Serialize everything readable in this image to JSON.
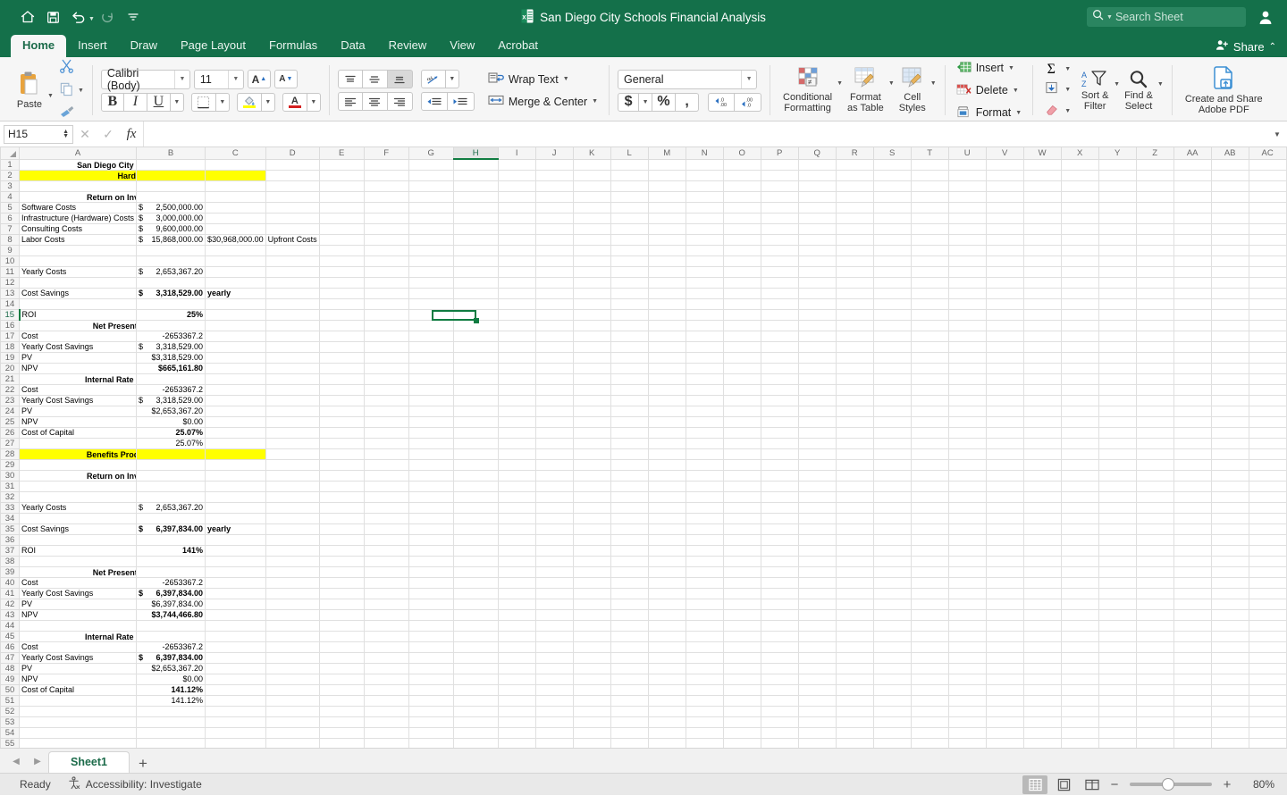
{
  "titlebar": {
    "document_title": "San Diego City Schools Financial Analysis",
    "search_placeholder": "Search Sheet",
    "quick_access": [
      {
        "name": "home-icon",
        "label": "Home"
      },
      {
        "name": "save-icon",
        "label": "Save"
      },
      {
        "name": "undo-icon",
        "label": "Undo"
      },
      {
        "name": "redo-icon",
        "label": "Redo"
      },
      {
        "name": "customize-toolbar-icon",
        "label": "Customize"
      }
    ],
    "account_icon": "account-icon"
  },
  "tabs": [
    {
      "label": "Home",
      "active": true
    },
    {
      "label": "Insert",
      "active": false
    },
    {
      "label": "Draw",
      "active": false
    },
    {
      "label": "Page Layout",
      "active": false
    },
    {
      "label": "Formulas",
      "active": false
    },
    {
      "label": "Data",
      "active": false
    },
    {
      "label": "Review",
      "active": false
    },
    {
      "label": "View",
      "active": false
    },
    {
      "label": "Acrobat",
      "active": false
    }
  ],
  "share": {
    "label": "Share",
    "collapse_icon": "chevron-up-icon"
  },
  "ribbon": {
    "paste": "Paste",
    "cut": "cut-icon",
    "copy": "copy-icon",
    "format_painter": "format-painter-icon",
    "font_name": "Calibri (Body)",
    "font_size": "11",
    "grow_font": "A",
    "shrink_font": "A",
    "bold": "B",
    "italic": "I",
    "underline": "U",
    "wrap_text": "Wrap Text",
    "merge_center": "Merge & Center",
    "number_format": "General",
    "currency": "$",
    "percent": "%",
    "comma": ",",
    "decrease_decimal": ".00",
    "increase_decimal": ".00",
    "conditional_formatting": "Conditional\nFormatting",
    "conditional_formatting_l1": "Conditional",
    "conditional_formatting_l2": "Formatting",
    "format_as_table_l1": "Format",
    "format_as_table_l2": "as Table",
    "cell_styles_l1": "Cell",
    "cell_styles_l2": "Styles",
    "insert": "Insert",
    "delete": "Delete",
    "format": "Format",
    "autosum": "Σ",
    "fill": "fill-icon",
    "clear": "clear-icon",
    "sort_filter_l1": "Sort &",
    "sort_filter_l2": "Filter",
    "find_select_l1": "Find &",
    "find_select_l2": "Select",
    "adobe_l1": "Create and Share",
    "adobe_l2": "Adobe PDF"
  },
  "formula_bar": {
    "name_box": "H15",
    "cancel_icon": "close-icon",
    "enter_icon": "check-icon",
    "fx_icon": "fx-icon",
    "formula_value": "",
    "expand_icon": "chevron-down-icon"
  },
  "grid": {
    "selected_cell": "H15",
    "selected_column": "H",
    "selected_row": 15,
    "columns": [
      "A",
      "B",
      "C",
      "D",
      "E",
      "F",
      "G",
      "H",
      "I",
      "J",
      "K",
      "L",
      "M",
      "N",
      "O",
      "P",
      "Q",
      "R",
      "S",
      "T",
      "U",
      "V",
      "W",
      "X",
      "Y",
      "Z",
      "AA",
      "AB",
      "AC"
    ],
    "total_rows": 56,
    "cells": {
      "1": {
        "B": {
          "t": "San Diego City Schools Financial Analysis",
          "s": "b ctr",
          "span": "A-D"
        }
      },
      "2": {
        "B": {
          "t": "Hard Costs",
          "s": "b ctr hl",
          "span": "A-C"
        }
      },
      "4": {
        "B": {
          "t": "Return on Investment (ROI)",
          "s": "b ctr",
          "span": "A-C"
        }
      },
      "5": {
        "A": {
          "t": "Software Costs"
        },
        "B": {
          "t": "$|2,500,000.00",
          "s": "money"
        }
      },
      "6": {
        "A": {
          "t": "Infrastructure (Hardware) Costs"
        },
        "B": {
          "t": "$|3,000,000.00",
          "s": "money"
        }
      },
      "7": {
        "A": {
          "t": "Consulting Costs"
        },
        "B": {
          "t": "$|9,600,000.00",
          "s": "money"
        }
      },
      "8": {
        "A": {
          "t": "Labor Costs"
        },
        "B": {
          "t": "$|15,868,000.00",
          "s": "money"
        },
        "C": {
          "t": "$|30,968,000.00",
          "s": "money"
        },
        "D": {
          "t": "Upfront Costs"
        }
      },
      "11": {
        "A": {
          "t": "Yearly Costs"
        },
        "B": {
          "t": "$|2,653,367.20",
          "s": "money"
        }
      },
      "13": {
        "A": {
          "t": "Cost Savings"
        },
        "B": {
          "t": "$|3,318,529.00",
          "s": "money b"
        },
        "C": {
          "t": "yearly",
          "s": "b"
        }
      },
      "15": {
        "A": {
          "t": "ROI"
        },
        "B": {
          "t": "25%",
          "s": "rt b"
        }
      },
      "16": {
        "B": {
          "t": "Net Present Value (NPR)",
          "s": "b ctr",
          "span": "A-C"
        }
      },
      "17": {
        "A": {
          "t": "Cost"
        },
        "B": {
          "t": "-2653367.2",
          "s": "rt"
        }
      },
      "18": {
        "A": {
          "t": "Yearly Cost Savings"
        },
        "B": {
          "t": "$|3,318,529.00",
          "s": "money"
        }
      },
      "19": {
        "A": {
          "t": "PV"
        },
        "B": {
          "t": "$3,318,529.00",
          "s": "rt"
        }
      },
      "20": {
        "A": {
          "t": "NPV"
        },
        "B": {
          "t": "$665,161.80",
          "s": "rt b"
        }
      },
      "21": {
        "B": {
          "t": "Internal Rate of Return (IRR)",
          "s": "b ctr",
          "span": "A-C"
        }
      },
      "22": {
        "A": {
          "t": "Cost"
        },
        "B": {
          "t": "-2653367.2",
          "s": "rt"
        }
      },
      "23": {
        "A": {
          "t": "Yearly Cost Savings"
        },
        "B": {
          "t": "$|3,318,529.00",
          "s": "money"
        }
      },
      "24": {
        "A": {
          "t": "PV"
        },
        "B": {
          "t": "$2,653,367.20",
          "s": "rt"
        }
      },
      "25": {
        "A": {
          "t": "NPV"
        },
        "B": {
          "t": "$0.00",
          "s": "rt"
        }
      },
      "26": {
        "A": {
          "t": "Cost of Capital"
        },
        "B": {
          "t": "25.07%",
          "s": "rt b"
        }
      },
      "27": {
        "B": {
          "t": "25.07%",
          "s": "rt"
        }
      },
      "28": {
        "B": {
          "t": "Benefits Productivity Gains",
          "s": "b ctr hl",
          "span": "A-C"
        }
      },
      "30": {
        "B": {
          "t": "Return on Investment (ROI)",
          "s": "b ctr",
          "span": "A-C"
        }
      },
      "33": {
        "A": {
          "t": "Yearly Costs"
        },
        "B": {
          "t": "$|2,653,367.20",
          "s": "money"
        }
      },
      "35": {
        "A": {
          "t": "Cost Savings"
        },
        "B": {
          "t": "$|6,397,834.00",
          "s": "money b"
        },
        "C": {
          "t": "yearly",
          "s": "b"
        }
      },
      "37": {
        "A": {
          "t": "ROI"
        },
        "B": {
          "t": "141%",
          "s": "rt b"
        }
      },
      "39": {
        "B": {
          "t": "Net Present Value (NPR)",
          "s": "b ctr",
          "span": "A-C"
        }
      },
      "40": {
        "A": {
          "t": "Cost"
        },
        "B": {
          "t": "-2653367.2",
          "s": "rt"
        }
      },
      "41": {
        "A": {
          "t": "Yearly Cost Savings"
        },
        "B": {
          "t": "$|6,397,834.00",
          "s": "money b"
        }
      },
      "42": {
        "A": {
          "t": "PV"
        },
        "B": {
          "t": "$6,397,834.00",
          "s": "rt"
        }
      },
      "43": {
        "A": {
          "t": "NPV"
        },
        "B": {
          "t": "$3,744,466.80",
          "s": "rt b"
        }
      },
      "45": {
        "B": {
          "t": "Internal Rate of Return (IRR)",
          "s": "b ctr",
          "span": "A-C"
        }
      },
      "46": {
        "A": {
          "t": "Cost"
        },
        "B": {
          "t": "-2653367.2",
          "s": "rt"
        }
      },
      "47": {
        "A": {
          "t": "Yearly Cost Savings"
        },
        "B": {
          "t": "$|6,397,834.00",
          "s": "money b"
        }
      },
      "48": {
        "A": {
          "t": "PV"
        },
        "B": {
          "t": "$2,653,367.20",
          "s": "rt"
        }
      },
      "49": {
        "A": {
          "t": "NPV"
        },
        "B": {
          "t": "$0.00",
          "s": "rt"
        }
      },
      "50": {
        "A": {
          "t": "Cost of Capital"
        },
        "B": {
          "t": "141.12%",
          "s": "rt b"
        }
      },
      "51": {
        "B": {
          "t": "141.12%",
          "s": "rt"
        }
      }
    }
  },
  "sheetbar": {
    "prev_icon": "chevron-left-icon",
    "next_icon": "chevron-right-icon",
    "sheets": [
      {
        "label": "Sheet1",
        "active": true
      }
    ],
    "add_label": "+"
  },
  "statusbar": {
    "status": "Ready",
    "accessibility": "Accessibility: Investigate",
    "accessibility_icon": "accessibility-icon",
    "views": [
      {
        "name": "normal-view-icon",
        "active": true
      },
      {
        "name": "page-layout-view-icon",
        "active": false
      },
      {
        "name": "page-break-view-icon",
        "active": false
      }
    ],
    "zoom_out": "−",
    "zoom_in": "+",
    "zoom_level": "80%"
  },
  "colors": {
    "brand_green": "#14704a",
    "accent_green": "#107c41",
    "highlight_yellow": "#ffff00",
    "ribbon_bg": "#f6f6f6"
  }
}
